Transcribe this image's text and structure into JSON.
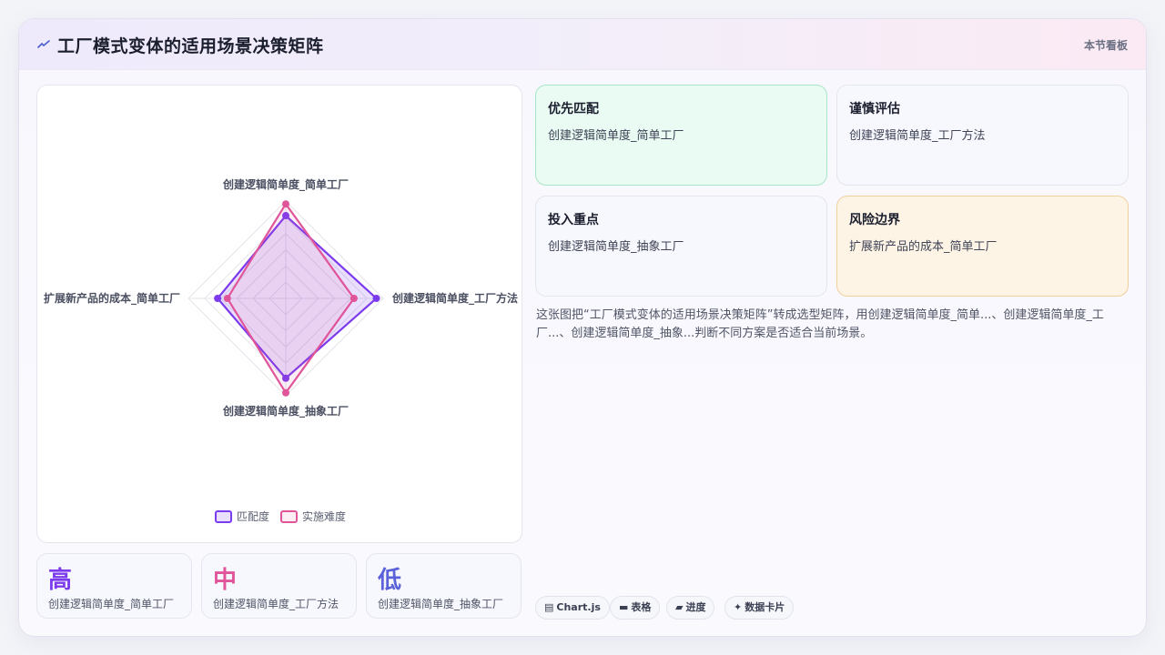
{
  "header": {
    "title": "工厂模式变体的适用场景决策矩阵",
    "badge": "本节看板",
    "icon": "sparkle-icon"
  },
  "chart_data": {
    "type": "radar",
    "axes": [
      "创建逻辑简单度_简单工厂",
      "创建逻辑简单度_工厂方法",
      "创建逻辑简单度_抽象工厂",
      "扩展新产品的成本_简单工厂"
    ],
    "series": [
      {
        "name": "匹配度",
        "values": [
          8.5,
          9.3,
          8.2,
          7.0
        ],
        "color": "#7c3aed"
      },
      {
        "name": "实施难度",
        "values": [
          9.7,
          7.0,
          9.7,
          6.0
        ],
        "color": "#e0559a"
      }
    ],
    "rmax": 10,
    "grid_levels": 6,
    "legend": "bottom"
  },
  "stats": [
    {
      "big": "高",
      "sub": "创建逻辑简单度_简单工厂",
      "color": "#7c3aed"
    },
    {
      "big": "中",
      "sub": "创建逻辑简单度_工厂方法",
      "color": "#e0559a"
    },
    {
      "big": "低",
      "sub": "创建逻辑简单度_抽象工厂",
      "color": "#5b61d9"
    }
  ],
  "quadrants": [
    {
      "title": "优先匹配",
      "text": "创建逻辑简单度_简单工厂"
    },
    {
      "title": "谨慎评估",
      "text": "创建逻辑简单度_工厂方法"
    },
    {
      "title": "投入重点",
      "text": "创建逻辑简单度_抽象工厂"
    },
    {
      "title": "风险边界",
      "text": "扩展新产品的成本_简单工厂"
    }
  ],
  "description": "这张图把“工厂模式变体的适用场景决策矩阵”转成选型矩阵，用创建逻辑简单度_简单...、创建逻辑简单度_工厂...、创建逻辑简单度_抽象...判断不同方案是否适合当前场景。",
  "chips": [
    {
      "icon": "chart-icon",
      "glyph": "▤",
      "label": "Chart.js"
    },
    {
      "icon": "table-icon",
      "glyph": "▬",
      "label": "表格"
    },
    {
      "icon": "progress-icon",
      "glyph": "▰",
      "label": "进度"
    },
    {
      "icon": "data-card-icon",
      "glyph": "✦",
      "label": "数据卡片"
    }
  ]
}
